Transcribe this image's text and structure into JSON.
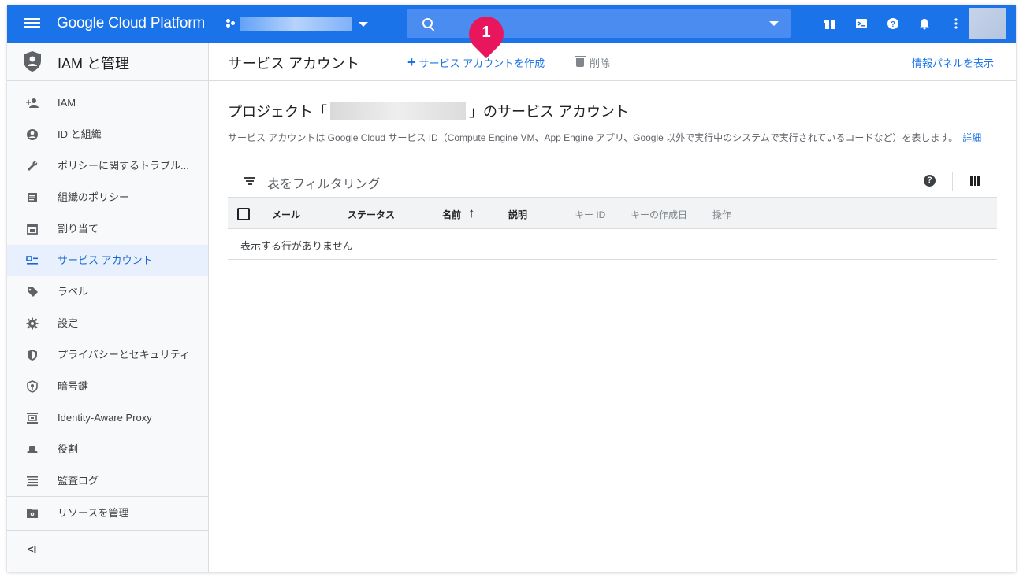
{
  "topbar": {
    "brand": "Google Cloud Platform",
    "project_caret_icon": "caret-down-icon",
    "search_icon": "search-icon",
    "icons": [
      "gift-icon",
      "cloud-shell-icon",
      "help-icon",
      "notifications-icon",
      "more-vert-icon"
    ],
    "bg_color": "#1a73e8"
  },
  "callout": {
    "number": "1",
    "color": "#e8175d"
  },
  "sidebar": {
    "title": "IAM と管理",
    "items": [
      {
        "label": "IAM",
        "icon": "person-add-icon"
      },
      {
        "label": "ID と組織",
        "icon": "account-circle-icon"
      },
      {
        "label": "ポリシーに関するトラブル...",
        "icon": "wrench-icon"
      },
      {
        "label": "組織のポリシー",
        "icon": "list-alt-icon"
      },
      {
        "label": "割り当て",
        "icon": "calendar-icon"
      },
      {
        "label": "サービス アカウント",
        "icon": "service-account-icon",
        "active": true
      },
      {
        "label": "ラベル",
        "icon": "label-icon"
      },
      {
        "label": "設定",
        "icon": "gear-icon"
      },
      {
        "label": "プライバシーとセキュリティ",
        "icon": "shield-icon"
      },
      {
        "label": "暗号鍵",
        "icon": "key-shield-icon"
      },
      {
        "label": "Identity-Aware Proxy",
        "icon": "iap-icon"
      },
      {
        "label": "役割",
        "icon": "hat-icon"
      },
      {
        "label": "監査ログ",
        "icon": "list-lines-icon"
      }
    ],
    "manage_resources": "リソースを管理",
    "collapse": "<I"
  },
  "toolbar": {
    "title": "サービス アカウント",
    "create": "サービス アカウントを作成",
    "delete": "削除",
    "info_panel": "情報パネルを表示"
  },
  "content": {
    "title_prefix": "プロジェクト「",
    "title_suffix": "」のサービス アカウント",
    "description": "サービス アカウントは Google Cloud サービス ID（Compute Engine VM、App Engine アプリ、Google 以外で実行中のシステムで実行されているコードなど）を表します。",
    "details_link": "詳細"
  },
  "table": {
    "filter_placeholder": "表をフィルタリング",
    "columns": [
      "メール",
      "ステータス",
      "名前",
      "説明",
      "キー ID",
      "キーの作成日",
      "操作"
    ],
    "sorted_column": "名前",
    "empty_message": "表示する行がありません"
  }
}
